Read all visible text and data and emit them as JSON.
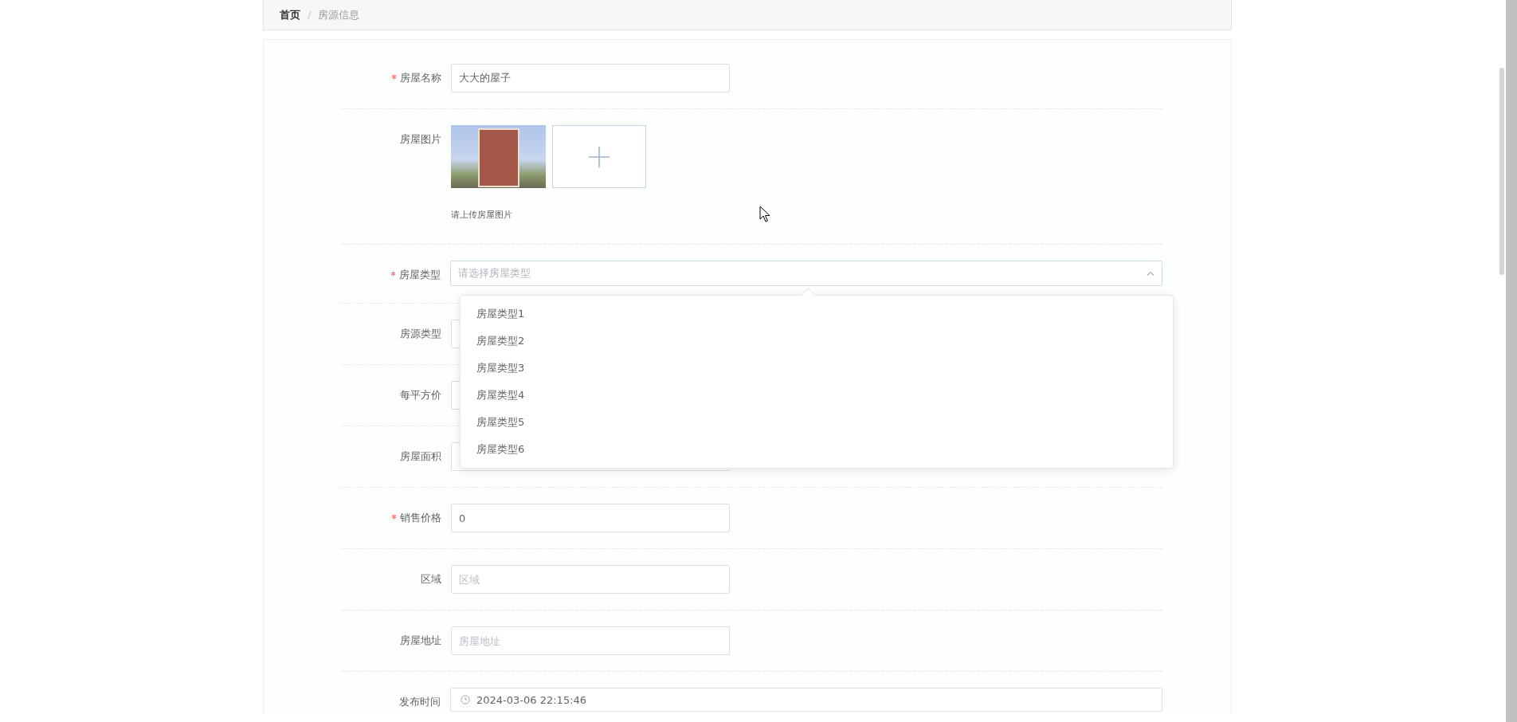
{
  "breadcrumb": {
    "separator": "/",
    "items": [
      {
        "label": "首页",
        "current": false
      },
      {
        "label": "房源信息",
        "current": true
      }
    ]
  },
  "form": {
    "rows": [
      {
        "kind": "text",
        "label": "房屋名称",
        "required": true,
        "value": "大大的屋子"
      },
      {
        "kind": "upload",
        "label": "房屋图片",
        "required": false,
        "hint": "请上传房屋图片"
      },
      {
        "kind": "select",
        "label": "房屋类型",
        "required": true,
        "placeholder": "请选择房屋类型",
        "expanded": true,
        "options": [
          {
            "label": "房屋类型1",
            "selected": false
          },
          {
            "label": "房屋类型2",
            "selected": false
          },
          {
            "label": "房屋类型3",
            "selected": false
          },
          {
            "label": "房屋类型4",
            "selected": false
          },
          {
            "label": "房屋类型5",
            "selected": false
          },
          {
            "label": "房屋类型6",
            "selected": false
          }
        ]
      },
      {
        "kind": "text",
        "label": "房源类型",
        "required": false
      },
      {
        "kind": "text",
        "label": "每平方价",
        "required": false
      },
      {
        "kind": "text",
        "label": "房屋面积",
        "required": false
      },
      {
        "kind": "text",
        "label": "销售价格",
        "required": true,
        "value": "0"
      },
      {
        "kind": "text",
        "label": "区域",
        "required": false,
        "placeholder": "区域"
      },
      {
        "kind": "text",
        "label": "房屋地址",
        "required": false,
        "placeholder": "房屋地址"
      },
      {
        "kind": "datetime",
        "label": "发布时间",
        "required": false,
        "value": "2024-03-06 22:15:46"
      }
    ]
  }
}
